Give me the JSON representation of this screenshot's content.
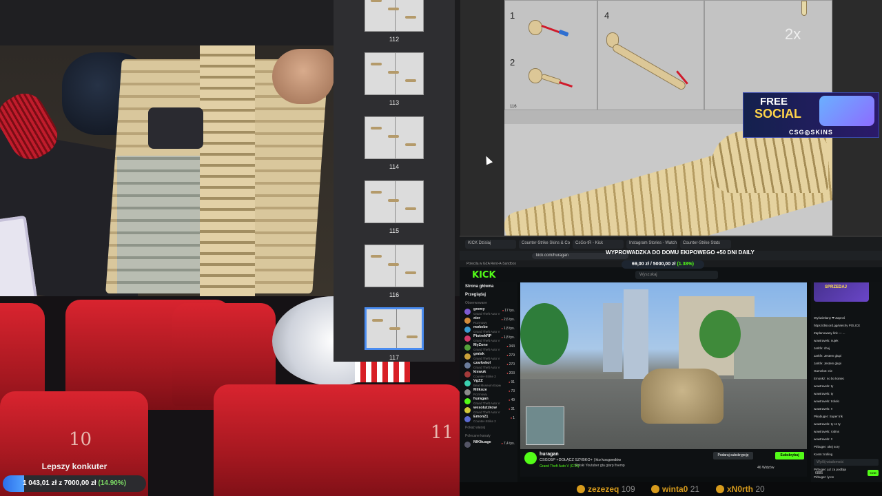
{
  "goal_widget": {
    "title": "Lepszy konkuter",
    "current": "1 043,01 zł",
    "separator": "z",
    "target": "7000,00 zł",
    "percent_text": "(14.90%)",
    "fraction": 0.149
  },
  "thumbnails": [
    {
      "label": "112",
      "active": false
    },
    {
      "label": "113",
      "active": false
    },
    {
      "label": "114",
      "active": false
    },
    {
      "label": "115",
      "active": false
    },
    {
      "label": "116",
      "active": false
    },
    {
      "label": "117",
      "active": true
    }
  ],
  "instructions": {
    "steps": [
      "1",
      "2",
      "4"
    ],
    "multiplier": "2x",
    "page_number": "116"
  },
  "ad": {
    "line1": "FREE",
    "line2": "SOCIAL",
    "brand": "CSG◎SKINS"
  },
  "cinema": {
    "seat_numbers": [
      "10",
      "11"
    ]
  },
  "browser": {
    "tabs": [
      "KICK Dzisiaj",
      "Counter-Strike Skins & Cosmetics",
      "CsGo-tR - Kick",
      "Instagram Stories - Watch",
      "Counter-Strike Stats"
    ],
    "url": "kick.com/huragan",
    "bookmarks": "Polecila w G2A   Rent-A-Sandbox"
  },
  "kick": {
    "logo": "KICK",
    "search_placeholder": "Wyszukaj",
    "banner": "WYPROWADZKA DO DOMU EKIPOWEGO +50 DNI DAILY",
    "banner_goal": "69,00 zł / 5000,00 zł",
    "banner_goal_pct": "(1.38%)",
    "sidebar_home": "Strona główna",
    "sidebar_browse": "Przeglądaj",
    "sidebar_following": "Obserwowane",
    "channels": [
      {
        "name": "gremy",
        "game": "Grand Theft Auto V",
        "viewers": "17 tys."
      },
      {
        "name": "xter",
        "game": "Rozmowy",
        "viewers": "2,6 tys."
      },
      {
        "name": "mokebe",
        "game": "Grand Theft Auto V",
        "viewers": "1,8 tys."
      },
      {
        "name": "PiotrekRP",
        "game": "Grand Theft Auto V",
        "viewers": "1,8 tys."
      },
      {
        "name": "MyZone",
        "game": "Grand Theft Auto V",
        "viewers": "343"
      },
      {
        "name": "gmisk",
        "game": "Grand Theft Auto V",
        "viewers": "279"
      },
      {
        "name": "czarkekol",
        "game": "Grand Theft Auto V",
        "viewers": "270"
      },
      {
        "name": "kiswuk",
        "game": "Counter-Strike 2",
        "viewers": "203"
      },
      {
        "name": "VgZZ",
        "game": "Beat Museum Expedition",
        "viewers": "91"
      },
      {
        "name": "Milkoze",
        "game": "Rozmowy",
        "viewers": "73"
      },
      {
        "name": "huragan",
        "game": "Grand Theft Auto V",
        "viewers": "49"
      },
      {
        "name": "wesolutzkow",
        "game": "Grand Theft Auto V",
        "viewers": "31"
      },
      {
        "name": "Emon21",
        "game": "Counter-Strike 2",
        "viewers": "1"
      }
    ],
    "sidebar_more": "Pokaż więcej",
    "sidebar_recommended": "Polecane kanały",
    "recommended_channel": {
      "name": "NIKItuage",
      "viewers": "7,4 tys."
    },
    "stream": {
      "streamer": "huragan",
      "title": "CSGO5P +DOŁĄCZ SZYBKO+ | kto kosgoedów",
      "game": "Grand Theft Auto V (GTA)",
      "tags": "Polski   Youtuber   gta   gtarp   fivemp",
      "subscribe": "Podaruj subskrypcję",
      "follow": "Subskrybuj",
      "viewers": "46 Widzów"
    },
    "chat_promo": "SPRZEDAJ",
    "chat_messages": [
      "Wyświetlany ❤ Zaproś",
      "https://discord.gg/wtechy POLICE",
      "Zaplanowany link — ...",
      "wowtravels: nujek",
      "Jarkfe: chuj",
      "Jarkfe: Jestem glupi",
      "Jarkfe: Jestem glupi",
      "Gamebot: nie",
      "Emonkz: no bo koniec",
      "wowtravels: ty",
      "wowtravels: ty",
      "wowtravels: trololo",
      "wowtravels: !!",
      "Pikabuger: Super trik",
      "wowtravels: ty cz ty",
      "wowtravels: robins",
      "wowtravels: !!",
      "Pirbuger: okej sory",
      "Kosm: trolling",
      "Pirbuger: jestem mila",
      "Pirbuger: już za podbija",
      "Pirbuger: lyron",
      "Leontowicz: hah"
    ],
    "chat_input_placeholder": "Wyślij wiadomość",
    "chat_points": "6885",
    "chat_send": "Czat"
  },
  "leaderboard": [
    {
      "name": "zezezeq",
      "score": "109"
    },
    {
      "name": "winta0",
      "score": "21"
    },
    {
      "name": "xN0rth",
      "score": "20"
    }
  ],
  "colors": {
    "kick_green": "#53fc18",
    "goal_blue": "#2d6ee8",
    "seat_red": "#d9242f"
  }
}
